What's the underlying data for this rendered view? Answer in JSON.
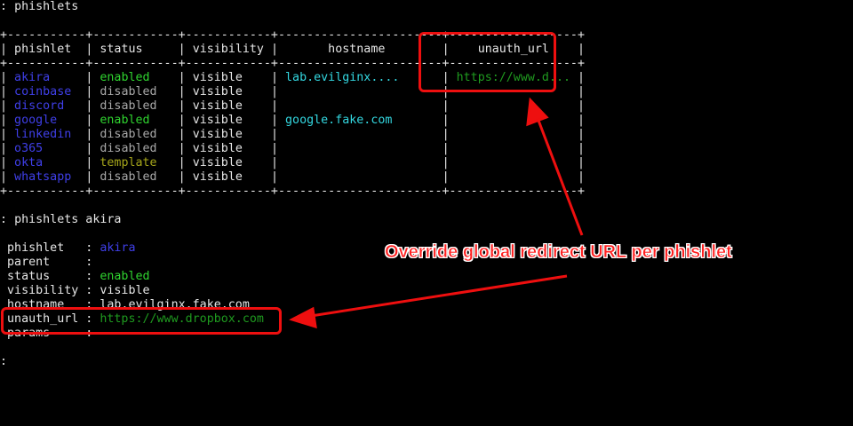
{
  "terminal": {
    "prompt": ":",
    "command1": "phishlets",
    "command2": "phishlets akira",
    "final_prompt": ":"
  },
  "table": {
    "top_border": "+-----------+------------+------------+-----------------------+------------------+",
    "header_border": "+-----------+------------+------------+-----------------------+------------------+",
    "bottom_border": "+-----------+------------+------------+-----------------------+------------------+",
    "sep": "|",
    "headers": [
      "phishlet",
      "status",
      "visibility",
      "hostname",
      "unauth_url"
    ],
    "rows": [
      {
        "phishlet": "akira",
        "status": "enabled",
        "status_kind": "enabled",
        "visibility": "visible",
        "hostname": "lab.evilginx....",
        "unauth_url": "https://www.d..."
      },
      {
        "phishlet": "coinbase",
        "status": "disabled",
        "status_kind": "disabled",
        "visibility": "visible",
        "hostname": "",
        "unauth_url": ""
      },
      {
        "phishlet": "discord",
        "status": "disabled",
        "status_kind": "disabled",
        "visibility": "visible",
        "hostname": "",
        "unauth_url": ""
      },
      {
        "phishlet": "google",
        "status": "enabled",
        "status_kind": "enabled",
        "visibility": "visible",
        "hostname": "google.fake.com",
        "unauth_url": ""
      },
      {
        "phishlet": "linkedin",
        "status": "disabled",
        "status_kind": "disabled",
        "visibility": "visible",
        "hostname": "",
        "unauth_url": ""
      },
      {
        "phishlet": "o365",
        "status": "disabled",
        "status_kind": "disabled",
        "visibility": "visible",
        "hostname": "",
        "unauth_url": ""
      },
      {
        "phishlet": "okta",
        "status": "template",
        "status_kind": "template",
        "visibility": "visible",
        "hostname": "",
        "unauth_url": ""
      },
      {
        "phishlet": "whatsapp",
        "status": "disabled",
        "status_kind": "disabled",
        "visibility": "visible",
        "hostname": "",
        "unauth_url": ""
      }
    ]
  },
  "details": {
    "rows": [
      {
        "key": "phishlet",
        "value": "akira",
        "value_color": "blue"
      },
      {
        "key": "parent",
        "value": "",
        "value_color": "white"
      },
      {
        "key": "status",
        "value": "enabled",
        "value_color": "green"
      },
      {
        "key": "visibility",
        "value": "visible",
        "value_color": "white"
      },
      {
        "key": "hostname",
        "value": "lab.evilginx.fake.com",
        "value_color": "white"
      },
      {
        "key": "unauth_url",
        "value": "https://www.dropbox.com",
        "value_color": "dgreen"
      },
      {
        "key": "params",
        "value": "",
        "value_color": "white"
      }
    ]
  },
  "annotation": {
    "text": "Override global redirect URL per phishlet",
    "color": "#ff2020",
    "box_color": "#ee0f0f"
  },
  "colors": {
    "background": "#000000",
    "text": "#e6e6e6",
    "phishlet_name": "#3f3fe8",
    "enabled": "#2fd42f",
    "disabled": "#a8a8a8",
    "template": "#a5a51a",
    "hostname": "#33d7e0",
    "url": "#1f9a1f"
  }
}
